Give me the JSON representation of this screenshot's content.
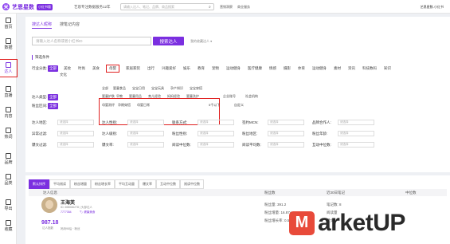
{
  "topbar": {
    "logo_mark": "米",
    "logo_text": "艺恩星数",
    "logo_badge": "小红书版",
    "slogan": "艺恩专注数据服务12年",
    "search_placeholder": "请输入达人、笔记、品牌、商品搜索",
    "links": [
      "营销洞察",
      "商业服务"
    ],
    "user": "艺恩星数-小红书"
  },
  "sidebar": {
    "items": [
      {
        "label": "首页",
        "icon": "home-icon"
      },
      {
        "label": "数据",
        "icon": "chart-icon"
      },
      {
        "label": "达人",
        "icon": "person-icon",
        "active": true
      },
      {
        "label": "直播",
        "icon": "live-icon"
      },
      {
        "label": "内容",
        "icon": "document-icon"
      },
      {
        "label": "热词",
        "icon": "fire-icon"
      },
      {
        "label": "品牌",
        "icon": "brand-icon"
      },
      {
        "label": "品类",
        "icon": "grid-icon"
      },
      {
        "label": "导出",
        "icon": "export-icon"
      },
      {
        "label": "收藏",
        "icon": "star-icon"
      }
    ]
  },
  "search": {
    "tabs": [
      "搜达人昵称",
      "搜笔记内容"
    ],
    "placeholder": "请输入达人名称或者小红书ID",
    "button": "搜索达人",
    "collect": "我的收藏达人 ▾"
  },
  "filters": {
    "section_title": "筛选条件",
    "industry_label": "行业分类:",
    "industry_all": "全部",
    "industry": [
      "美妆",
      "时尚",
      "美食",
      "母婴",
      "家居家装",
      "出行",
      "兴趣爱好",
      "娱乐",
      "教育",
      "宠物",
      "运动健身",
      "医疗健康",
      "情感",
      "摄影",
      "体育",
      "运动健身",
      "素材",
      "资讯",
      "科技数码",
      "知识"
    ],
    "industry_extra": "文化",
    "selected_industry": "母婴",
    "subcats_row1": [
      "全部",
      "婴童食品",
      "宝宝日用",
      "宝宝玩具",
      "孕产知识",
      "宝宝穿搭"
    ],
    "subcats_row2": [
      "婴童护肤",
      "早教",
      "婴童用品",
      "育儿经验",
      "妈妈经验",
      "婴童洗护"
    ],
    "subcats_row3": [
      "母婴测评",
      "孕期穿搭",
      "母婴日常"
    ],
    "type_label": "达人类型:",
    "type_all": "全部",
    "type_extra": [
      "企业账号",
      "社会机构"
    ],
    "fans_label": "粉丝区间:",
    "fans_all": "全部",
    "fans_extra": [
      "5千以下",
      "自定义"
    ],
    "selects": [
      [
        "达人地区:",
        "达人性别:",
        "联系方式:",
        "签约MCN:",
        "品牌合作人:"
      ],
      [
        "异常过滤:",
        "达人级别:",
        "粉丝性别:",
        "粉丝地区:",
        "粉丝年龄:"
      ],
      [
        "爆文过滤:",
        "爆文率:",
        "阅读中位数:",
        "阅读平均数:",
        "互动中位数:"
      ]
    ],
    "select_placeholder": "请选择"
  },
  "results": {
    "sort_tabs": [
      "默认排序",
      "平均阅读",
      "粉丝增量",
      "粉丝增长率",
      "平均互动量",
      "爆文率",
      "互动中位数",
      "阅读中位数"
    ],
    "headers": [
      "达人信息",
      "粉丝数",
      "近30日笔记",
      "中位数"
    ],
    "row": {
      "name": "王海芙",
      "id": "ID: 698066278 | 头部达人",
      "likes": "7777354",
      "tag1": "🏷 健康美食",
      "fans": "987.18",
      "fans_unit": "达人指数",
      "tags_line": "妈妈95后 · 粉丝",
      "stats": [
        "粉丝量: 391.2",
        "粉丝增量: 16.87w",
        "粉丝增长率: 0.5%"
      ],
      "notes": [
        "笔记数: 8",
        "阅读量",
        "爆文"
      ]
    }
  },
  "watermark": {
    "mark": "M",
    "text": "arketUP"
  }
}
